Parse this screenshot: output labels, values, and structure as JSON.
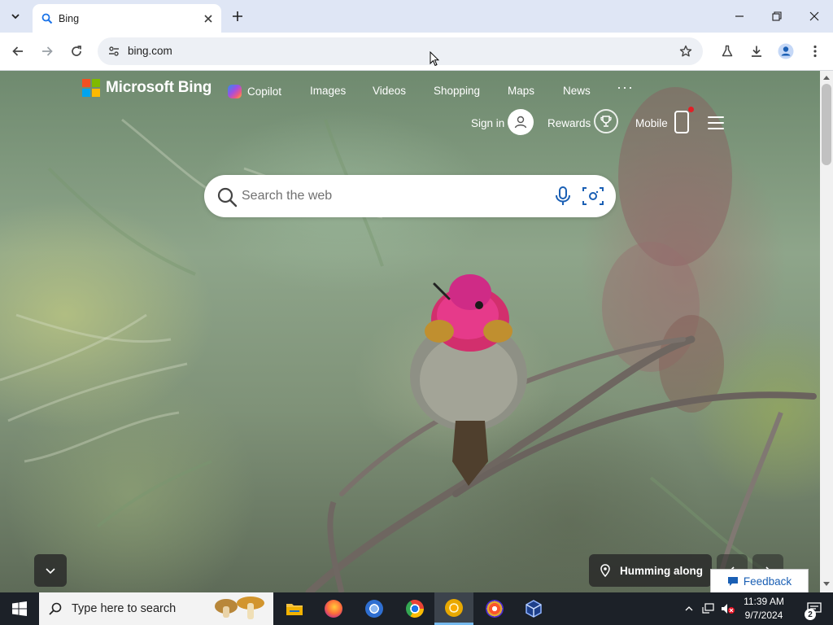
{
  "browser": {
    "tab_title": "Bing",
    "url": "bing.com",
    "colors": {
      "tabstrip": "#dfe6f5",
      "toolbar": "#ffffff",
      "omnibox": "#edf0f5"
    }
  },
  "bing": {
    "logo_text": "Microsoft Bing",
    "nav": {
      "copilot": "Copilot",
      "images": "Images",
      "videos": "Videos",
      "shopping": "Shopping",
      "maps": "Maps",
      "news": "News",
      "more": "···"
    },
    "header": {
      "sign_in": "Sign in",
      "rewards": "Rewards",
      "mobile": "Mobile"
    },
    "search": {
      "placeholder": "Search the web"
    },
    "image_caption": "Humming along",
    "feedback": "Feedback",
    "colors": {
      "ms_red": "#f25022",
      "ms_green": "#7fba00",
      "ms_blue": "#00a4ef",
      "ms_yellow": "#ffb900"
    }
  },
  "taskbar": {
    "search_text": "Type here to search",
    "time": "11:39 AM",
    "date": "9/7/2024",
    "notification_count": "2",
    "apps": [
      "file-explorer",
      "firefox",
      "chromium",
      "chrome",
      "chrome-canary",
      "brave",
      "virtualbox"
    ]
  }
}
